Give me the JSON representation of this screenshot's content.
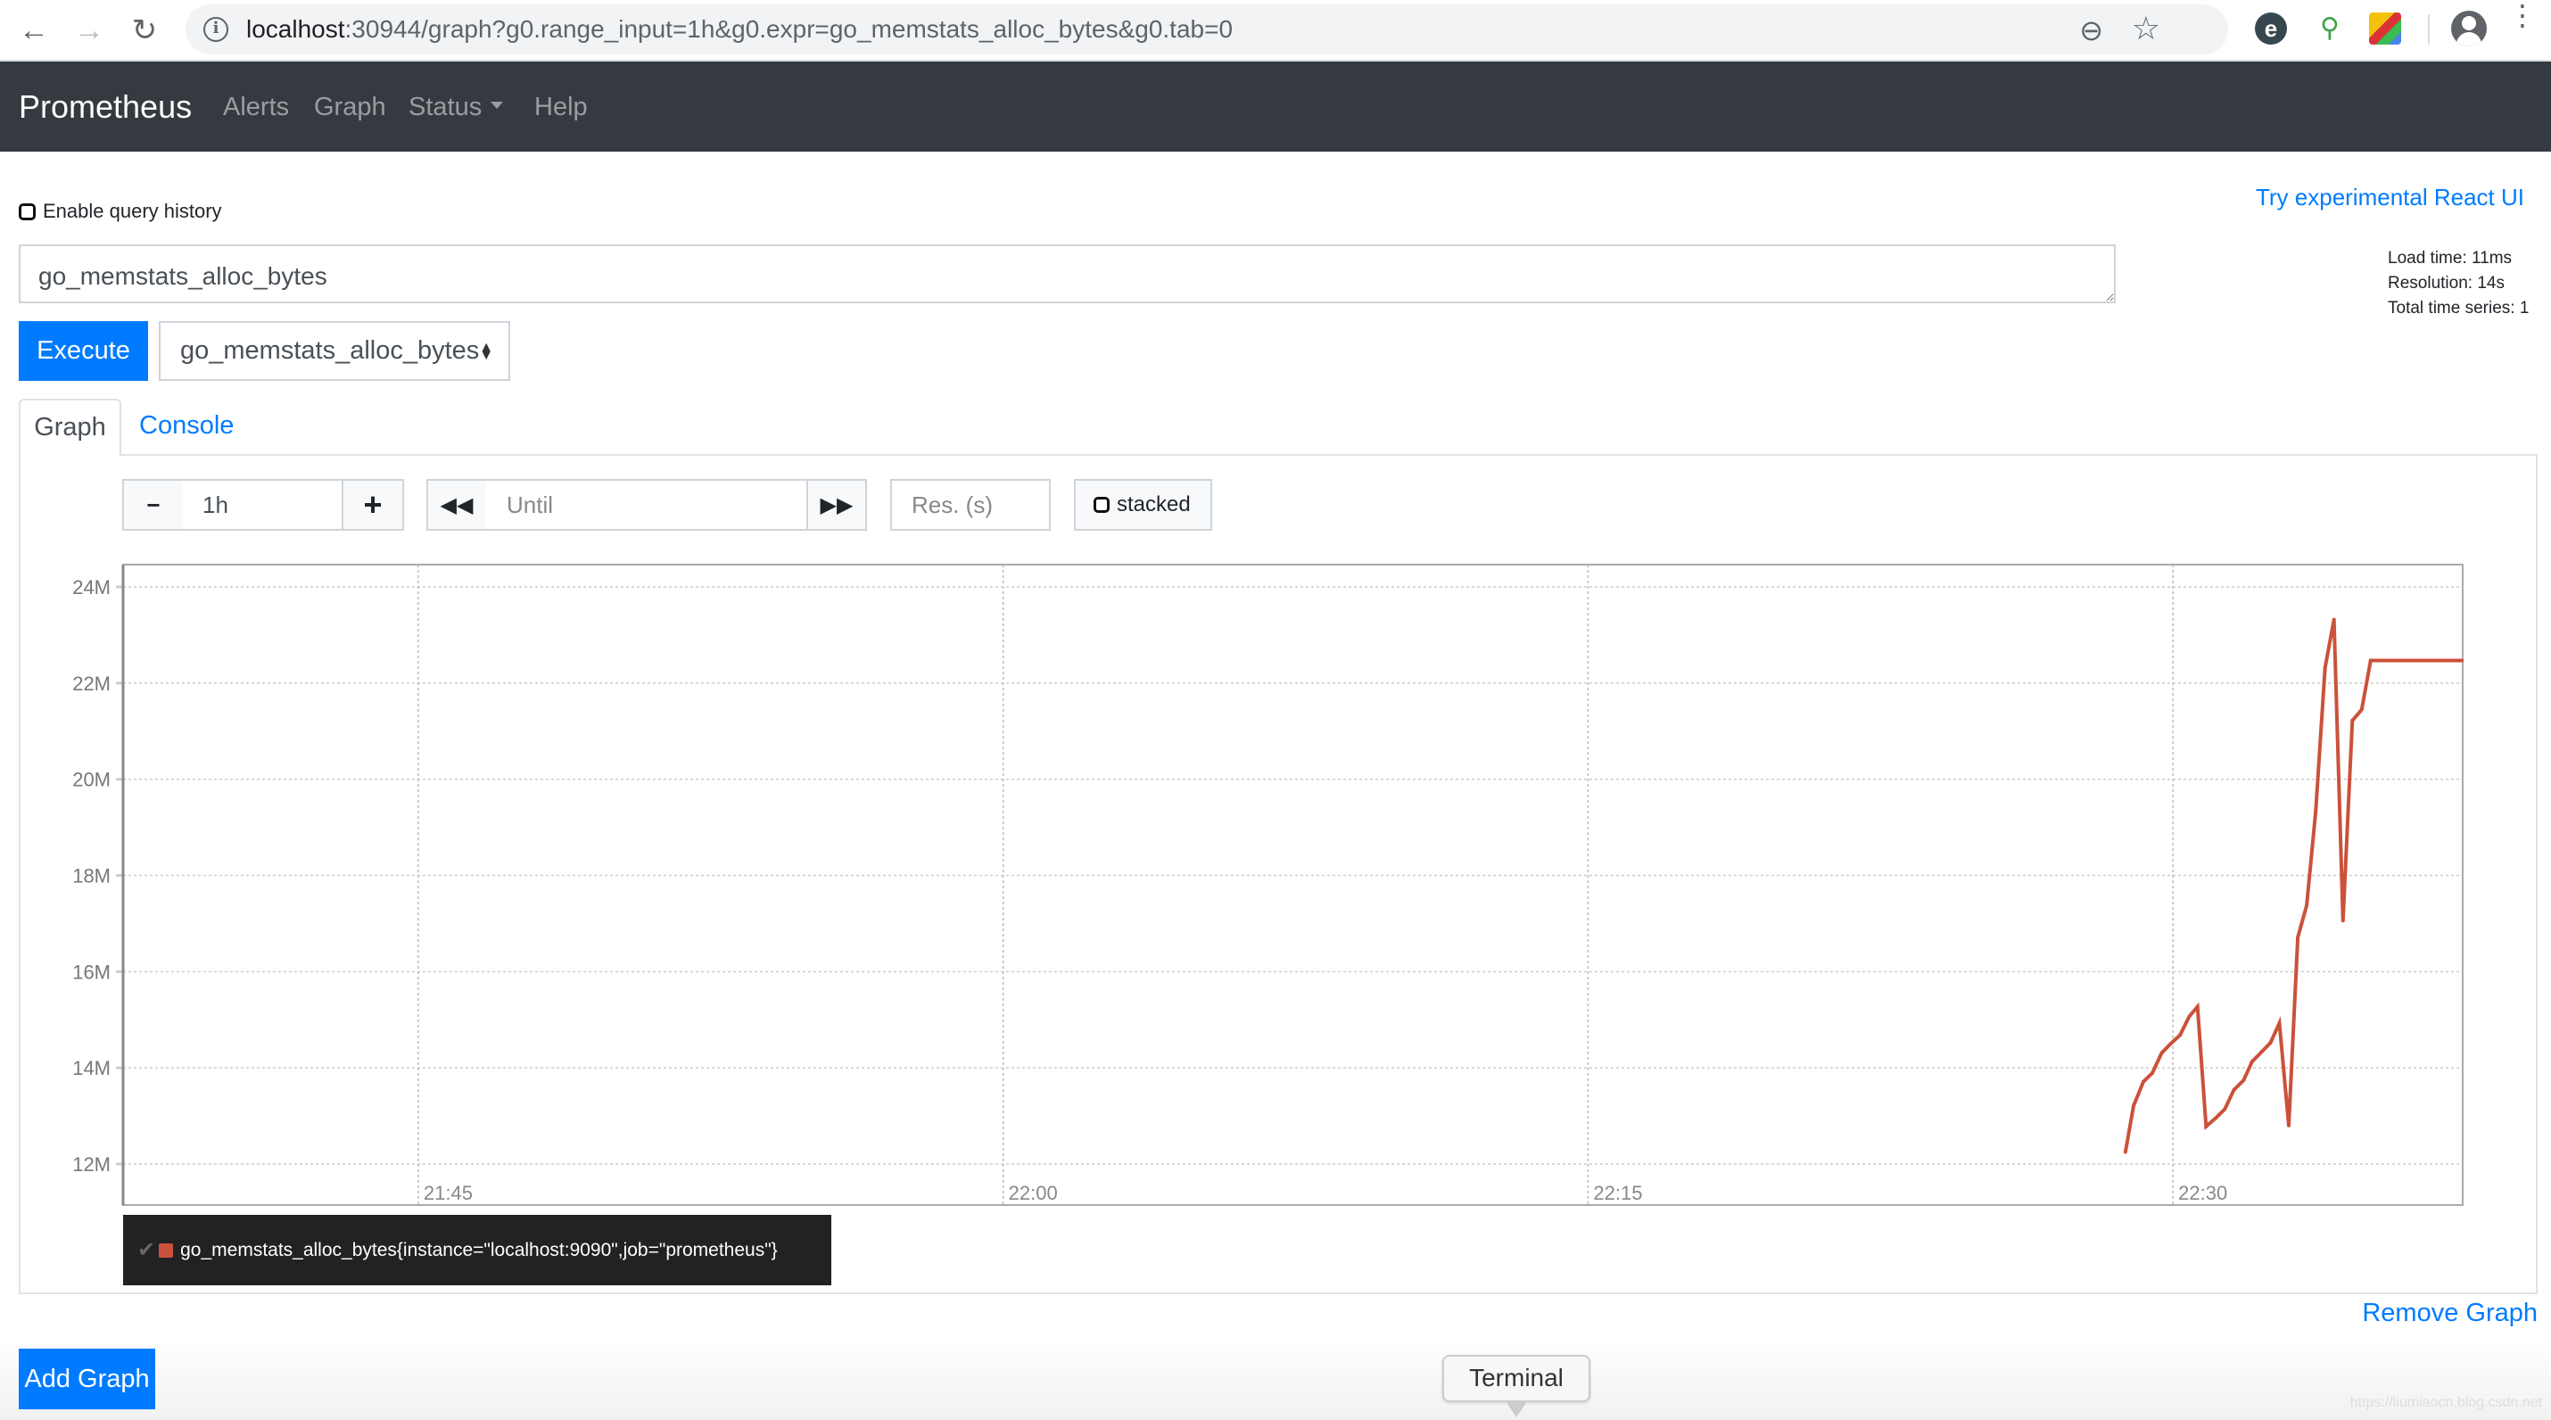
{
  "browser": {
    "url_host": "localhost",
    "url_rest": ":30944/graph?g0.range_input=1h&g0.expr=go_memstats_alloc_bytes&g0.tab=0",
    "icons": [
      "back-icon",
      "forward-icon",
      "reload-icon",
      "info-icon",
      "zoom-out-icon",
      "star-icon",
      "extension-icon",
      "extension-icon",
      "extension-icon",
      "profile-icon",
      "menu-icon"
    ]
  },
  "navbar": {
    "brand": "Prometheus",
    "links": [
      "Alerts",
      "Graph",
      "Status",
      "Help"
    ]
  },
  "query": {
    "history_label": "Enable query history",
    "history_checked": false,
    "react_link": "Try experimental React UI",
    "expression": "go_memstats_alloc_bytes",
    "execute_label": "Execute",
    "metric_select": "go_memstats_alloc_bytes"
  },
  "stats": {
    "load_time": "Load time: 11ms",
    "resolution": "Resolution: 14s",
    "total_series": "Total time series: 1"
  },
  "tabs": [
    {
      "label": "Graph",
      "active": true
    },
    {
      "label": "Console",
      "active": false
    }
  ],
  "controls": {
    "minus": "−",
    "range": "1h",
    "plus": "+",
    "back": "◀◀",
    "until_placeholder": "Until",
    "forward": "▶▶",
    "res_placeholder": "Res. (s)",
    "stacked_label": "stacked",
    "stacked_checked": false
  },
  "chart_data": {
    "type": "line",
    "title": "",
    "xlabel": "",
    "ylabel": "",
    "x_range": [
      "21:37:25",
      "22:37:25"
    ],
    "ylim": [
      11.2,
      24.4
    ],
    "y_unit": "M",
    "y_ticks": [
      12,
      14,
      16,
      18,
      20,
      22,
      24
    ],
    "y_tick_labels": [
      "12M",
      "14M",
      "16M",
      "18M",
      "20M",
      "22M",
      "24M"
    ],
    "x_ticks_min": [
      7.57,
      22.57,
      37.57,
      52.57
    ],
    "x_tick_labels": [
      "21:45",
      "22:00",
      "22:15",
      "22:30"
    ],
    "grid": true,
    "series": [
      {
        "name": "go_memstats_alloc_bytes{instance=\"localhost:9090\",job=\"prometheus\"}",
        "color": "#cb513a",
        "x_min": [
          51.35,
          51.56,
          51.81,
          52.04,
          52.28,
          52.51,
          52.75,
          52.99,
          53.2,
          53.42,
          53.66,
          53.9,
          54.13,
          54.38,
          54.6,
          54.83,
          55.07,
          55.3,
          55.54,
          55.77,
          56.0,
          56.23,
          56.47,
          56.7,
          56.93,
          57.17,
          57.41,
          57.64,
          59.98
        ],
        "values": [
          12.25,
          13.21,
          13.71,
          13.89,
          14.31,
          14.5,
          14.68,
          15.07,
          15.27,
          12.78,
          12.95,
          13.14,
          13.54,
          13.74,
          14.13,
          14.32,
          14.52,
          14.93,
          12.8,
          16.71,
          17.38,
          19.33,
          22.32,
          23.32,
          17.06,
          21.22,
          21.45,
          22.47,
          22.47
        ]
      }
    ],
    "legend": "bottom-left"
  },
  "legend": {
    "label": "go_memstats_alloc_bytes{instance=\"localhost:9090\",job=\"prometheus\"}"
  },
  "footer": {
    "remove_graph": "Remove Graph",
    "add_graph": "Add Graph",
    "terminal": "Terminal",
    "watermark": "https://liumiaocn.blog.csdn.net"
  }
}
